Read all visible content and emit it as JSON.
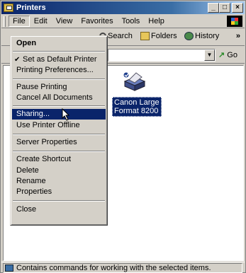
{
  "window": {
    "title": "Printers"
  },
  "menubar": {
    "items": [
      "File",
      "Edit",
      "View",
      "Favorites",
      "Tools",
      "Help"
    ]
  },
  "toolbar": {
    "search": "Search",
    "folders": "Folders",
    "history": "History",
    "more": "»"
  },
  "address": {
    "go": "Go"
  },
  "file_menu": {
    "open": "Open",
    "set_default": "Set as Default Printer",
    "printing_prefs": "Printing Preferences...",
    "pause_printing": "Pause Printing",
    "cancel_all": "Cancel All Documents",
    "sharing": "Sharing...",
    "use_offline": "Use Printer Offline",
    "server_props": "Server Properties",
    "create_shortcut": "Create Shortcut",
    "delete": "Delete",
    "rename": "Rename",
    "properties": "Properties",
    "close": "Close"
  },
  "content": {
    "printer_name": "Canon Large Format 8200"
  },
  "statusbar": {
    "text": "Contains commands for working with the selected items."
  }
}
